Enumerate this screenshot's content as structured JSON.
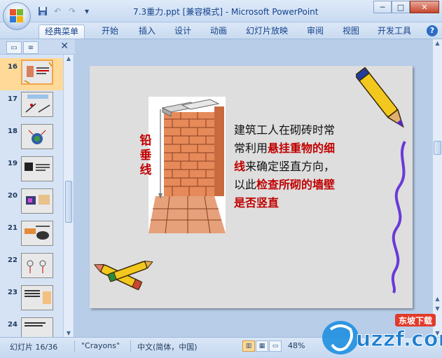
{
  "window": {
    "title": "7.3重力.ppt [兼容模式] - Microsoft PowerPoint",
    "minimize": "─",
    "maximize": "□",
    "close": "✕"
  },
  "quick_access": {
    "save_icon": "save-icon",
    "undo_icon": "undo-icon",
    "redo_icon": "redo-icon",
    "customize": "▾"
  },
  "ribbon": {
    "tabs": [
      {
        "label": "经典菜单",
        "active": true
      },
      {
        "label": "开始"
      },
      {
        "label": "插入"
      },
      {
        "label": "设计"
      },
      {
        "label": "动画"
      },
      {
        "label": "幻灯片放映"
      },
      {
        "label": "审阅"
      },
      {
        "label": "视图"
      },
      {
        "label": "开发工具"
      }
    ],
    "help": "?"
  },
  "left_panel": {
    "close": "✕",
    "thumbnails": [
      {
        "num": "16",
        "selected": true
      },
      {
        "num": "17"
      },
      {
        "num": "18"
      },
      {
        "num": "19"
      },
      {
        "num": "20"
      },
      {
        "num": "21"
      },
      {
        "num": "22"
      },
      {
        "num": "23"
      },
      {
        "num": "24"
      }
    ]
  },
  "slide": {
    "vertical_label": [
      "铅",
      "垂",
      "线"
    ],
    "text": {
      "line1": "建筑工人在砌砖时常",
      "line2_plain": "常利用",
      "line2_red": "悬挂重物的细",
      "line3_red": "线",
      "line3_plain": "来确定竖直方向，",
      "line4_plain": "以此",
      "line4_red": "检查所砌的墙壁",
      "line5_red": "是否竖直"
    }
  },
  "status_bar": {
    "slide_info": "幻灯片 16/36",
    "theme": "\"Crayons\"",
    "language": "中文(简体，中国)",
    "zoom": "48%"
  },
  "watermark": {
    "text": "uzzf.com",
    "sub": "东坡下载"
  },
  "colors": {
    "accent_red": "#c00000",
    "selected_thumb": "#ffd998",
    "slide_bg": "#dedede"
  }
}
